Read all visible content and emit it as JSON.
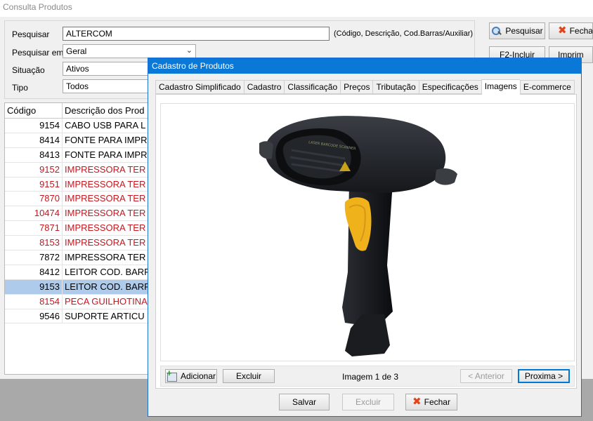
{
  "background_window": {
    "title": "Consulta Produtos",
    "filters": {
      "search_label": "Pesquisar",
      "search_value": "ALTERCOM",
      "search_hint": "(Código, Descrição, Cod.Barras/Auxiliar)",
      "search_in_label": "Pesquisar em",
      "search_in_value": "Geral",
      "status_label": "Situação",
      "status_value": "Ativos",
      "type_label": "Tipo",
      "type_value": "Todos"
    },
    "buttons": {
      "search": "Pesquisar",
      "close": "Fecha",
      "include": "F2-Incluir",
      "print": "Imprim"
    },
    "grid": {
      "columns": [
        "Código",
        "Descrição dos Prod"
      ],
      "rows": [
        {
          "code": "9154",
          "desc": "CABO USB PARA L",
          "color": "black"
        },
        {
          "code": "8414",
          "desc": "FONTE PARA IMPR",
          "color": "black"
        },
        {
          "code": "8413",
          "desc": "FONTE PARA IMPR",
          "color": "black"
        },
        {
          "code": "9152",
          "desc": "IMPRESSORA TER",
          "color": "red"
        },
        {
          "code": "9151",
          "desc": "IMPRESSORA TER",
          "color": "red"
        },
        {
          "code": "7870",
          "desc": "IMPRESSORA TER",
          "color": "red"
        },
        {
          "code": "10474",
          "desc": "IMPRESSORA TER",
          "color": "red"
        },
        {
          "code": "7871",
          "desc": "IMPRESSORA TER",
          "color": "red"
        },
        {
          "code": "8153",
          "desc": "IMPRESSORA TER",
          "color": "red"
        },
        {
          "code": "7872",
          "desc": "IMPRESSORA TER",
          "color": "black"
        },
        {
          "code": "8412",
          "desc": "LEITOR COD. BARR",
          "color": "black"
        },
        {
          "code": "9153",
          "desc": "LEITOR COD. BARR",
          "color": "black",
          "selected": true
        },
        {
          "code": "8154",
          "desc": "PECA GUILHOTINA",
          "color": "red"
        },
        {
          "code": "9546",
          "desc": "SUPORTE ARTICU",
          "color": "black"
        }
      ]
    }
  },
  "modal": {
    "title": "Cadastro de Produtos",
    "tabs": [
      "Cadastro Simplificado",
      "Cadastro",
      "Classificação",
      "Preços",
      "Tributação",
      "Especificações",
      "Imagens",
      "E-commerce"
    ],
    "active_tab": "Imagens",
    "image_panel": {
      "add_label": "Adicionar",
      "delete_label": "Excluir",
      "counter": "Imagem 1 de 3",
      "prev_label": "< Anterior",
      "next_label": "Proxima >",
      "scanner_text": "LASER BARCODE SCANNER"
    },
    "footer": {
      "save_label": "Salvar",
      "delete_label": "Excluir",
      "close_label": "Fechar"
    }
  },
  "colors": {
    "title_bar": "#0a78d7",
    "selected_row": "#aecbec",
    "red_text": "#c8161d",
    "scanner_trigger": "#f0b21a"
  }
}
